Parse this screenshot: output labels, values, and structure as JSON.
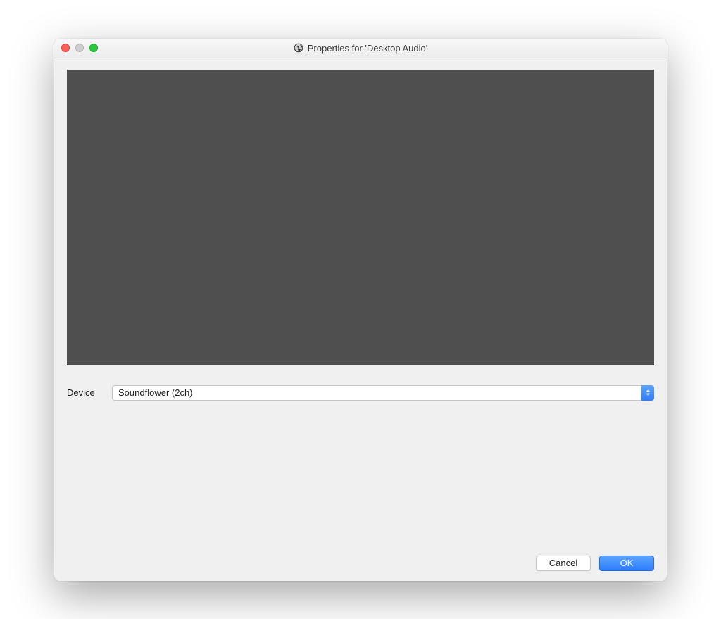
{
  "window": {
    "title": "Properties for 'Desktop Audio'",
    "app_icon": "obs-icon"
  },
  "form": {
    "device_label": "Device",
    "device_value": "Soundflower (2ch)"
  },
  "buttons": {
    "cancel": "Cancel",
    "ok": "OK"
  }
}
